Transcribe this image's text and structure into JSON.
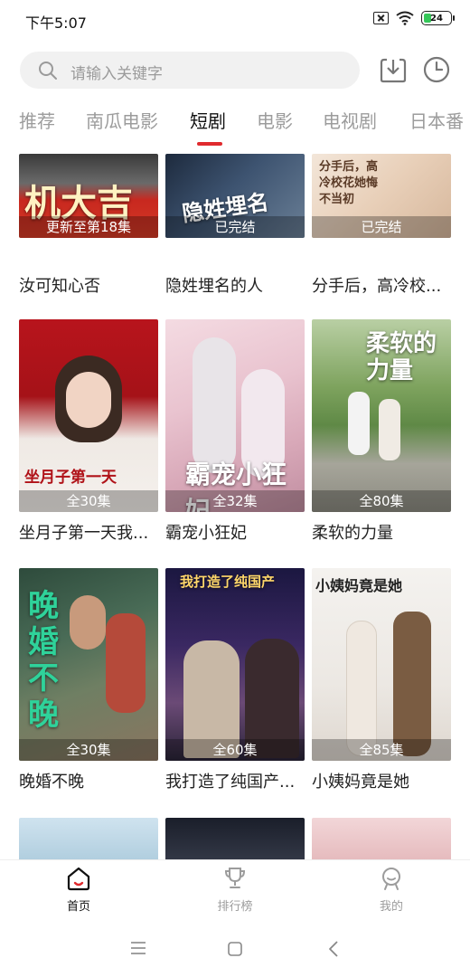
{
  "status_bar": {
    "time": "下午5:07",
    "battery": "24"
  },
  "search": {
    "placeholder": "请输入关键字"
  },
  "toolbar": {
    "download_icon": "download-icon",
    "history_icon": "clock-icon"
  },
  "tabs": [
    {
      "label": "推荐",
      "active": false
    },
    {
      "label": "南瓜电影",
      "active": false
    },
    {
      "label": "短剧",
      "active": true
    },
    {
      "label": "电影",
      "active": false
    },
    {
      "label": "电视剧",
      "active": false
    },
    {
      "label": "日本番",
      "active": false
    }
  ],
  "accent_color": "#e02a2e",
  "dramas": [
    {
      "title": "汝可知心否",
      "status": "更新至第18集",
      "poster_text": "机大吉"
    },
    {
      "title": "隐姓埋名的人",
      "status": "已完结",
      "poster_text": "隐姓埋名"
    },
    {
      "title": "分手后，高冷校...",
      "status": "已完结",
      "poster_text": "分手后，高冷校花她悔不当初"
    },
    {
      "title": "坐月子第一天我...",
      "status": "全30集",
      "poster_text": "坐月子第一天"
    },
    {
      "title": "霸宠小狂妃",
      "status": "全32集",
      "poster_text": "霸宠小狂妃"
    },
    {
      "title": "柔软的力量",
      "status": "全80集",
      "poster_text": "柔软的力量"
    },
    {
      "title": "晚婚不晚",
      "status": "全30集",
      "poster_text": "晚婚不晚"
    },
    {
      "title": "我打造了纯国产...",
      "status": "全60集",
      "poster_text": "我打造了纯国产"
    },
    {
      "title": "小姨妈竟是她",
      "status": "全85集",
      "poster_text": "小姨妈竟是她"
    }
  ],
  "bottom_nav": [
    {
      "label": "首页",
      "icon": "home-icon",
      "active": true
    },
    {
      "label": "排行榜",
      "icon": "trophy-icon",
      "active": false
    },
    {
      "label": "我的",
      "icon": "profile-icon",
      "active": false
    }
  ]
}
